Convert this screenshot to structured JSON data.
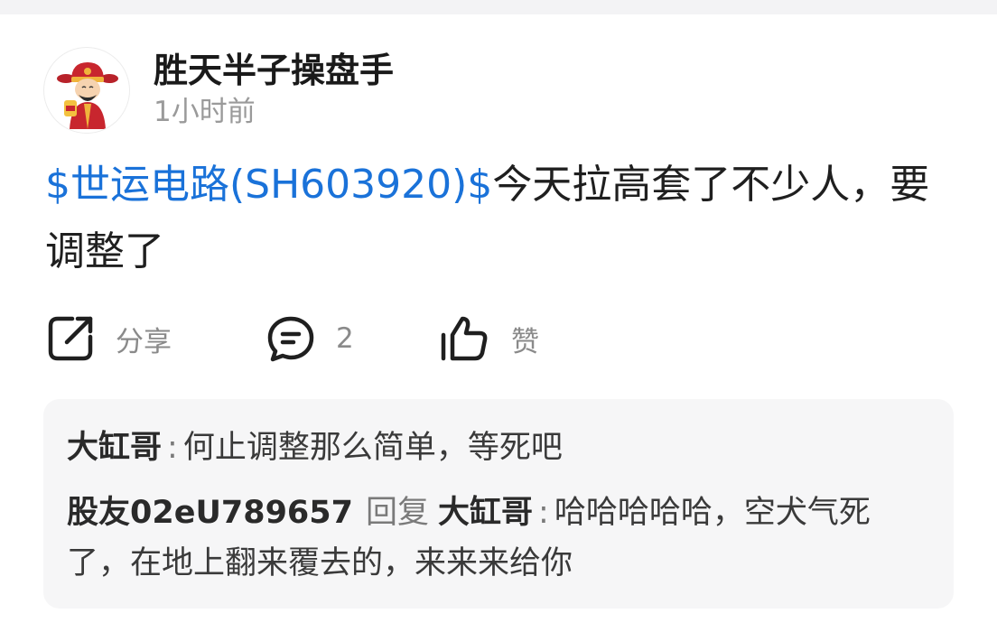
{
  "colors": {
    "link_blue": "#1a72d9",
    "muted_gray": "#8a8a8a",
    "comment_bg": "#f6f6f7",
    "text_dark": "#1f1f1f"
  },
  "post": {
    "author": "胜天半子操盘手",
    "time": "1小时前",
    "avatar_icon": "fortune-god-avatar",
    "stock_tag": "$世运电路(SH603920)$",
    "text": "今天拉高套了不少人，要调整了"
  },
  "actions": {
    "share": {
      "icon": "share-icon",
      "label": "分享"
    },
    "comment": {
      "icon": "comment-icon",
      "label": "2"
    },
    "like": {
      "icon": "thumbs-up-icon",
      "label": "赞"
    }
  },
  "comments": [
    {
      "author": "大缸哥",
      "separator": ":",
      "text": "何止调整那么简单，等死吧"
    },
    {
      "author": "股友02eU789657",
      "reply_word": "回复",
      "reply_to": "大缸哥",
      "separator": ":",
      "text": "哈哈哈哈哈，空犬气死了，在地上翻来覆去的，来来来给你"
    }
  ]
}
